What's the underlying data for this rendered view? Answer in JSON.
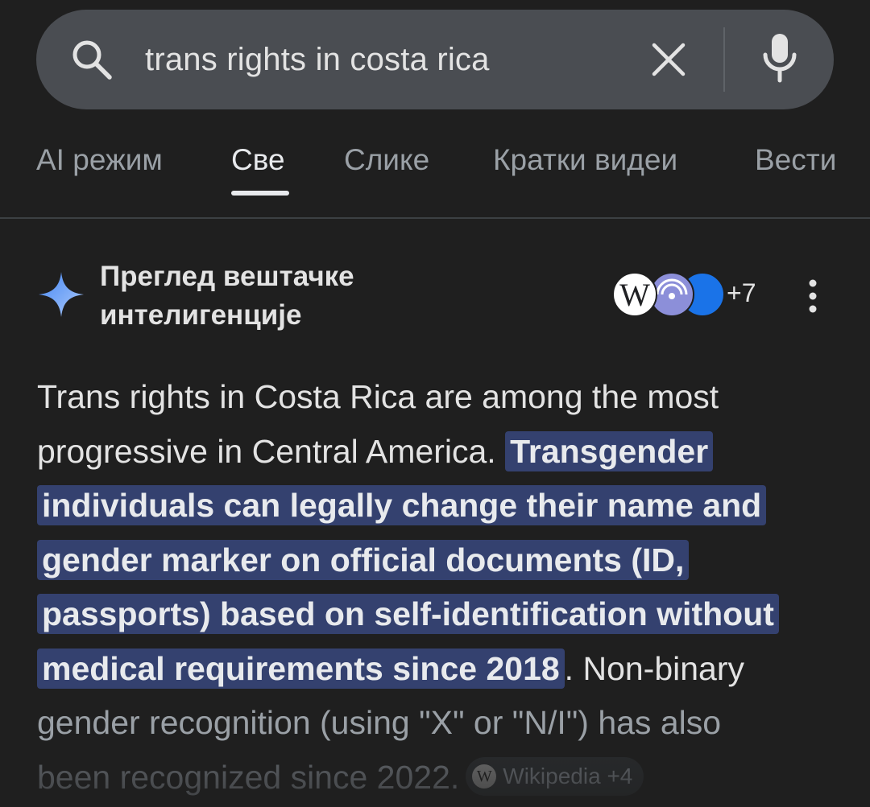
{
  "search": {
    "query": "trans rights in costa rica",
    "icons": [
      "search-icon",
      "clear-icon",
      "mic-icon"
    ]
  },
  "tabs": [
    {
      "label": "AI режим",
      "active": false
    },
    {
      "label": "Све",
      "active": true
    },
    {
      "label": "Слике",
      "active": false
    },
    {
      "label": "Кратки видеи",
      "active": false
    },
    {
      "label": "Вести",
      "active": false
    }
  ],
  "ai_overview": {
    "title_line1": "Преглед вештачке",
    "title_line2": "интелигенције",
    "source_count": "+7",
    "source_icons": [
      "wikipedia-icon",
      "podcast-icon",
      "site-icon"
    ],
    "answer": {
      "intro": "Trans rights in Costa Rica are among the most progressive in Central America. ",
      "highlight": "Transgender individuals can legally change their name and gender marker on official documents (ID, passports) based on self-identification without medical requirements since 2018",
      "after_highlight": ". Non-binary",
      "line_faded": "gender recognition (using \"X\" or \"N/I\") has also",
      "line_faded2": "been recognized since 2022.",
      "chip_label": "Wikipedia +4"
    }
  },
  "colors": {
    "background": "#1f1f1f",
    "searchbar": "#4a4d52",
    "highlight": "#34416f",
    "sparkle": "#8ab4f8"
  }
}
